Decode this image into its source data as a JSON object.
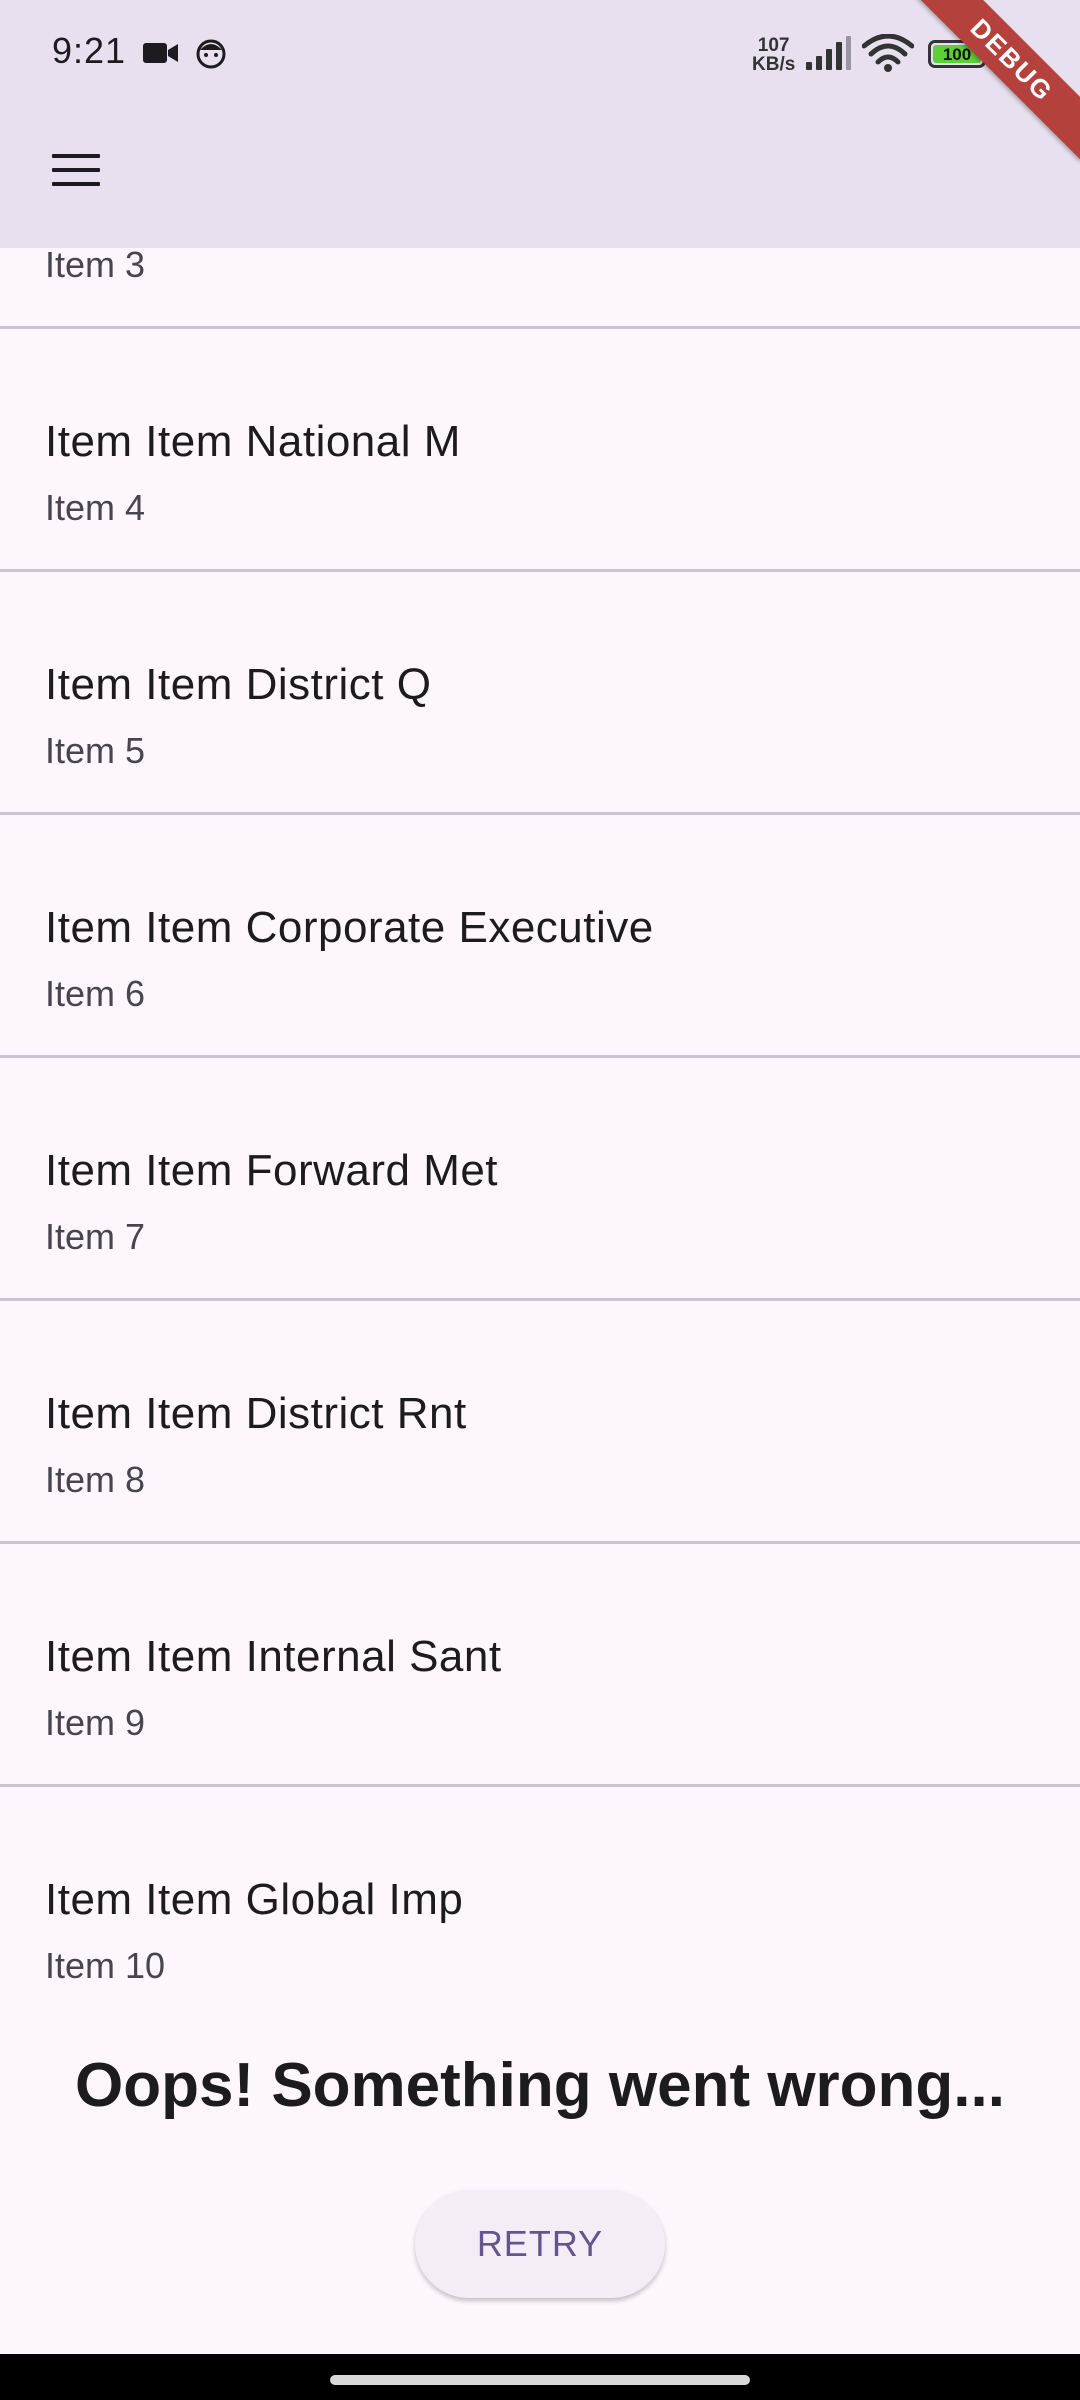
{
  "status_bar": {
    "time": "9:21",
    "left_icons": [
      "video-camera-icon",
      "notification-face-icon"
    ],
    "net_speed_value": "107",
    "net_speed_unit": "KB/s",
    "battery_level": "100"
  },
  "debug_banner": "DEBUG",
  "app_bar": {
    "menu_icon": "hamburger-menu-icon"
  },
  "list": {
    "partial_item": {
      "title": "",
      "subtitle": "Item 3"
    },
    "items": [
      {
        "title": "Item Item National M",
        "subtitle": "Item 4"
      },
      {
        "title": "Item Item District Q",
        "subtitle": "Item 5"
      },
      {
        "title": "Item Item Corporate Executive",
        "subtitle": "Item 6"
      },
      {
        "title": "Item Item Forward Met",
        "subtitle": "Item 7"
      },
      {
        "title": "Item Item District Rnt",
        "subtitle": "Item 8"
      },
      {
        "title": "Item Item Internal Sant",
        "subtitle": "Item 9"
      },
      {
        "title": "Item Item Global Imp",
        "subtitle": "Item 10"
      }
    ]
  },
  "error": {
    "message": "Oops! Something went wrong...",
    "retry_label": "RETRY"
  },
  "colors": {
    "app_bar_bg": "#e8e0ef",
    "page_bg": "#fdf7fd",
    "divider": "#cac4d0",
    "retry_text": "#65558f",
    "debug_ribbon": "#b4413c"
  }
}
